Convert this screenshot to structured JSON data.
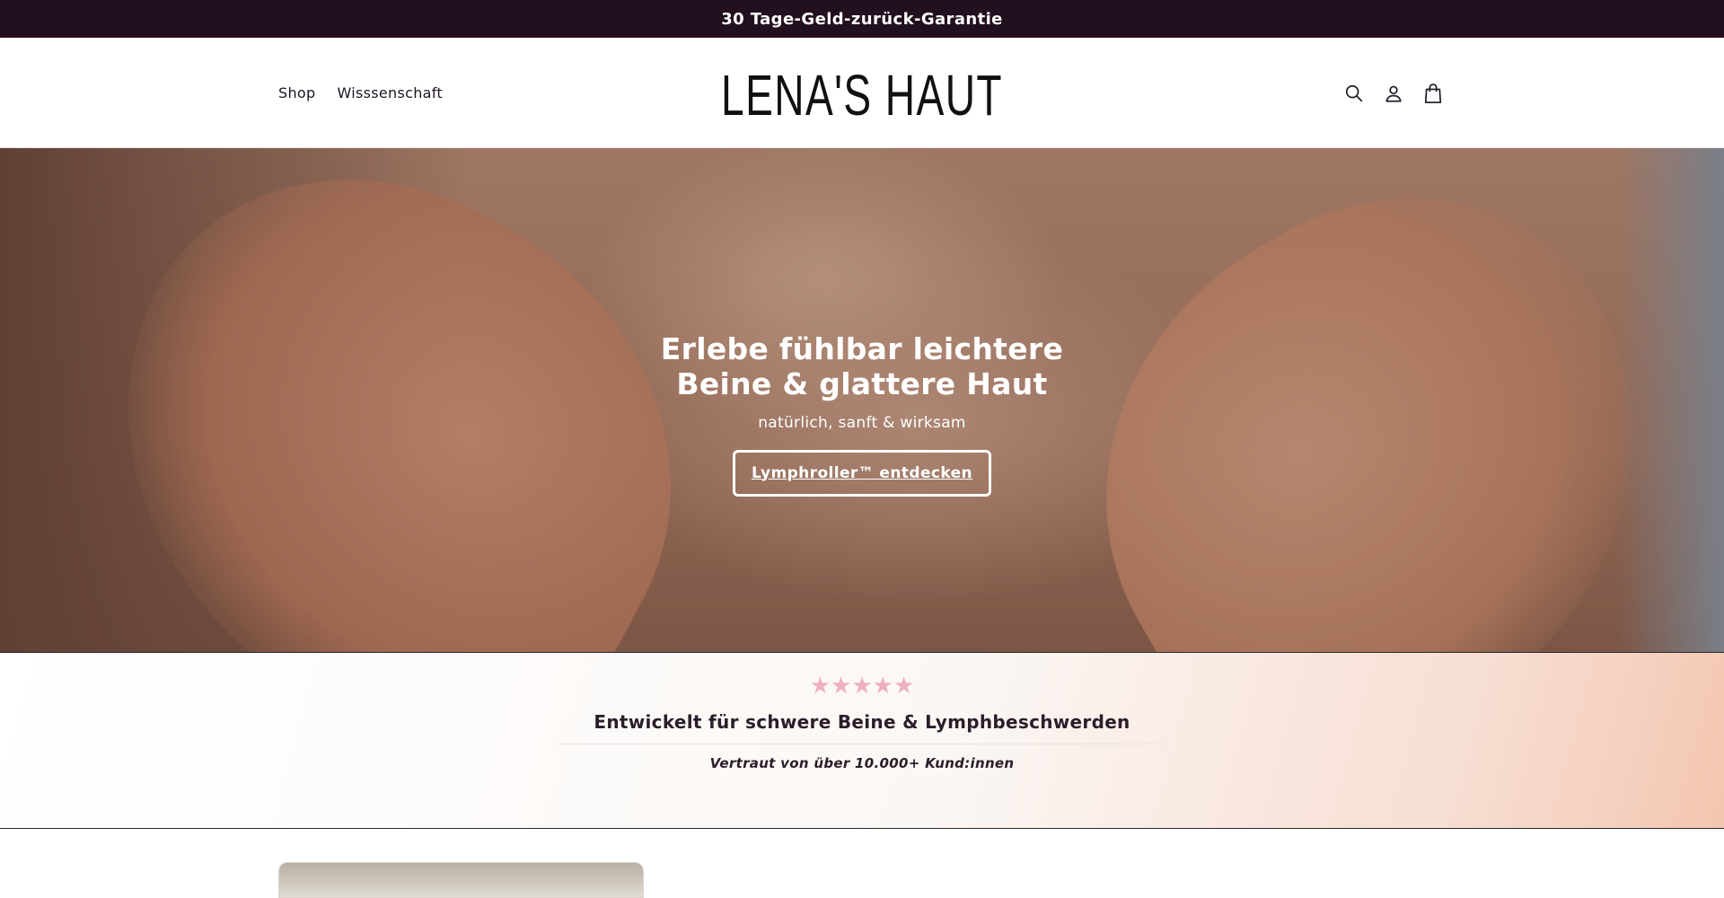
{
  "announcement": {
    "text": "30 Tage-Geld-zurück-Garantie"
  },
  "header": {
    "nav": [
      {
        "label": "Shop"
      },
      {
        "label": "Wisssenschaft"
      }
    ],
    "logo": "LENA'S HAUT",
    "icons": [
      "search-icon",
      "account-icon",
      "cart-icon"
    ]
  },
  "hero": {
    "title": "Erlebe fühlbar leichtere Beine & glattere Haut",
    "subtitle": "natürlich, sanft & wirksam",
    "cta": "Lymphroller™ entdecken"
  },
  "trust": {
    "stars": "★★★★★",
    "rating": 5,
    "star_color": "#eeb0c0",
    "title": "Entwickelt für schwere Beine & Lymphbeschwerden",
    "note": "Vertraut von über 10.000+ Kund:innen"
  },
  "colors": {
    "announcement_bg": "#23101f",
    "text": "#1c1420",
    "trust_gradient_end": "#f3c6b0"
  }
}
